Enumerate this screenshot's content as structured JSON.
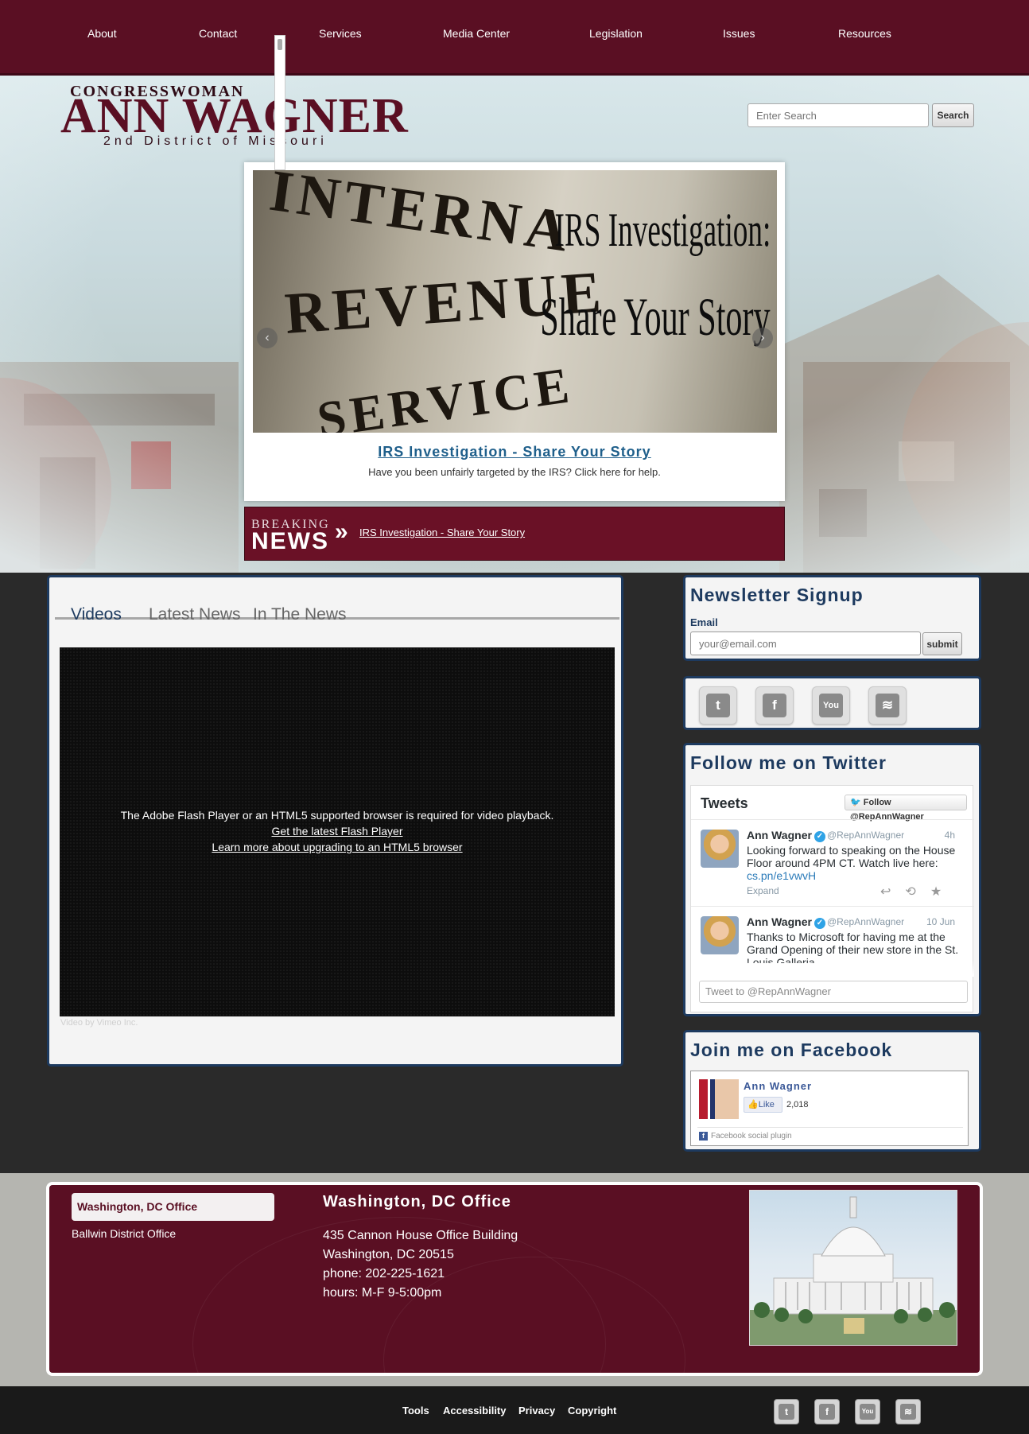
{
  "nav": {
    "items": [
      "About",
      "Contact",
      "Services",
      "Media Center",
      "Legislation",
      "Issues",
      "Resources"
    ]
  },
  "logo": {
    "top": "Congresswoman",
    "name": "ANN WAGNER",
    "district": "2nd District of Missouri"
  },
  "search": {
    "placeholder": "Enter Search",
    "button": "Search"
  },
  "slider": {
    "carved_text": [
      "INTERNA",
      "REVENUE",
      "SERVICE"
    ],
    "image_headline_1": "IRS Investigation:",
    "image_headline_2": "Share Your Story",
    "prev_icon": "chevron-left-icon",
    "next_icon": "chevron-right-icon",
    "title": "IRS Investigation - Share Your Story",
    "description": "Have you been unfairly targeted by the IRS? Click here for help."
  },
  "breaking": {
    "label_1": "BREAKING",
    "label_2": "NEWS",
    "link": "IRS Investigation - Share Your Story"
  },
  "media_tabs": {
    "tabs": [
      "Videos",
      "Latest News",
      "In The News"
    ],
    "active": "Videos",
    "video_message": "The Adobe Flash Player or an HTML5 supported browser is required for video playback.",
    "video_link_1": "Get the latest Flash Player",
    "video_link_2": "Learn more about upgrading to an HTML5 browser",
    "powered": "Video by Vimeo Inc."
  },
  "newsletter": {
    "title": "Newsletter Signup",
    "email_label": "Email",
    "placeholder": "your@email.com",
    "submit": "submit"
  },
  "social": {
    "icons": [
      "twitter-icon",
      "facebook-icon",
      "youtube-icon",
      "rss-icon"
    ],
    "glyphs": [
      "t",
      "f",
      "You",
      "≋"
    ]
  },
  "twitter": {
    "title": "Follow me on Twitter",
    "widget_title": "Tweets",
    "follow_button": "Follow @RepAnnWagner",
    "tweets": [
      {
        "name": "Ann Wagner",
        "handle": "@RepAnnWagner",
        "time": "4h",
        "text": "Looking forward to speaking on the House Floor around 4PM CT. Watch live here: ",
        "link": "cs.pn/e1vwvH",
        "expand": "Expand"
      },
      {
        "name": "Ann Wagner",
        "handle": "@RepAnnWagner",
        "time": "10 Jun",
        "text": "Thanks to Microsoft for having me at the Grand Opening of their new store in the St. Louis Galleria.",
        "link": "",
        "expand": ""
      }
    ],
    "compose_placeholder": "Tweet to @RepAnnWagner"
  },
  "facebook": {
    "title": "Join me on Facebook",
    "page_name": "Ann Wagner",
    "like": "Like",
    "count": "2,018",
    "plugin": "Facebook social plugin"
  },
  "offices": {
    "tabs": [
      "Washington, DC Office",
      "Ballwin District Office"
    ],
    "active_title": "Washington, DC Office",
    "address_1": "435 Cannon House Office Building",
    "address_2": "Washington, DC 20515",
    "phone": "phone: 202-225-1621",
    "hours": "hours: M-F 9-5:00pm"
  },
  "footer": {
    "links": [
      "Tools",
      "Accessibility",
      "Privacy",
      "Copyright"
    ]
  },
  "colors": {
    "brand": "#5a0f23",
    "accent": "#1d3a5f",
    "link": "#1f5f8b"
  }
}
